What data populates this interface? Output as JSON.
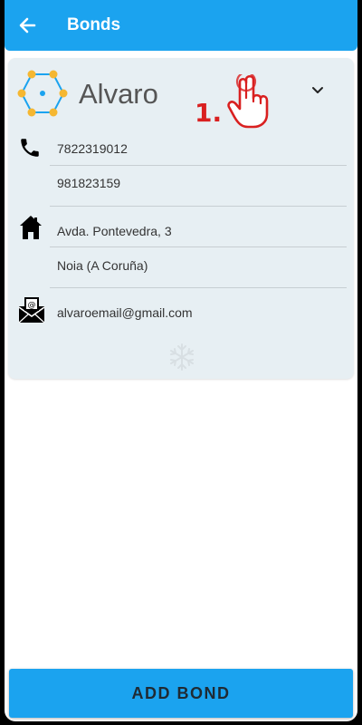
{
  "app_bar": {
    "title": "Bonds",
    "back_icon": "arrow-left-icon"
  },
  "bond_card": {
    "name": "Alvaro",
    "avatar_icon": "circle-network-icon",
    "expand_icon": "chevron-down-icon",
    "phone": {
      "icon": "phone-icon",
      "numbers": [
        "7822319012",
        "981823159"
      ]
    },
    "address": {
      "icon": "home-icon",
      "lines": [
        "Avda. Pontevedra, 3",
        "Noia (A Coruña)"
      ]
    },
    "email": {
      "icon": "email-icon",
      "value": "alvaroemail@gmail.com"
    },
    "footer_icon": "snowflake-icon"
  },
  "annotation": {
    "label": "1.",
    "icon": "pointing-hand-icon",
    "color": "#d92020"
  },
  "footer": {
    "add_bond_label": "ADD BOND"
  },
  "colors": {
    "primary": "#1ba3ef",
    "card_background": "#e7eff3",
    "avatar_node": "#f5b731"
  }
}
